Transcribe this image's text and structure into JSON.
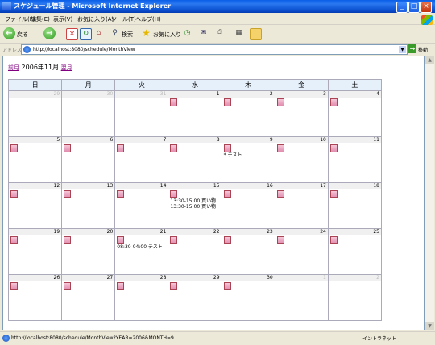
{
  "window": {
    "title": "スケジュール管理 - Microsoft Internet Explorer"
  },
  "menu": [
    "ファイル(F)",
    "編集(E)",
    "表示(V)",
    "お気に入り(A)",
    "ツール(T)",
    "ヘルプ(H)"
  ],
  "toolbar": {
    "back_label": "戻る",
    "search_label": "検索",
    "favorites_label": "お気に入り"
  },
  "address": {
    "label": "アドレス(D)",
    "url": "http://localhost:8080/schedule/MonthView",
    "go_label": "移動"
  },
  "calendar": {
    "prev_label": "前月",
    "month_label": "2006年11月",
    "next_label": "翌月",
    "weekdays": [
      "日",
      "月",
      "火",
      "水",
      "木",
      "金",
      "土"
    ],
    "weeks": [
      [
        {
          "day": "29",
          "other": true
        },
        {
          "day": "30",
          "other": true
        },
        {
          "day": "31",
          "other": true
        },
        {
          "day": "1",
          "note": true
        },
        {
          "day": "2",
          "note": true
        },
        {
          "day": "3",
          "note": true
        },
        {
          "day": "4",
          "note": true
        }
      ],
      [
        {
          "day": "5",
          "note": true
        },
        {
          "day": "6",
          "note": true
        },
        {
          "day": "7",
          "note": true
        },
        {
          "day": "8",
          "note": true
        },
        {
          "day": "9",
          "note": true,
          "events": [
            "* テスト"
          ]
        },
        {
          "day": "10",
          "note": true
        },
        {
          "day": "11",
          "note": true
        }
      ],
      [
        {
          "day": "12",
          "note": true
        },
        {
          "day": "13",
          "note": true
        },
        {
          "day": "14",
          "note": true
        },
        {
          "day": "15",
          "note": true,
          "events": [
            "13:30-15:00 買い物",
            "13:30-15:00 買い物"
          ]
        },
        {
          "day": "16",
          "note": true
        },
        {
          "day": "17",
          "note": true
        },
        {
          "day": "18",
          "note": true
        }
      ],
      [
        {
          "day": "19",
          "note": true
        },
        {
          "day": "20",
          "note": true
        },
        {
          "day": "21",
          "note": true,
          "events": [
            "08:30-04:00 テスト"
          ]
        },
        {
          "day": "22",
          "note": true
        },
        {
          "day": "23",
          "note": true
        },
        {
          "day": "24",
          "note": true
        },
        {
          "day": "25",
          "note": true
        }
      ],
      [
        {
          "day": "26",
          "note": true
        },
        {
          "day": "27",
          "note": true
        },
        {
          "day": "28",
          "note": true
        },
        {
          "day": "29",
          "note": true
        },
        {
          "day": "30",
          "note": true
        },
        {
          "day": "1",
          "other": true
        },
        {
          "day": "2",
          "other": true
        }
      ]
    ]
  },
  "status": {
    "text": "http://localhost:8080/schedule/MonthView?YEAR=2006&MONTH=9",
    "zone": "イントラネット"
  }
}
